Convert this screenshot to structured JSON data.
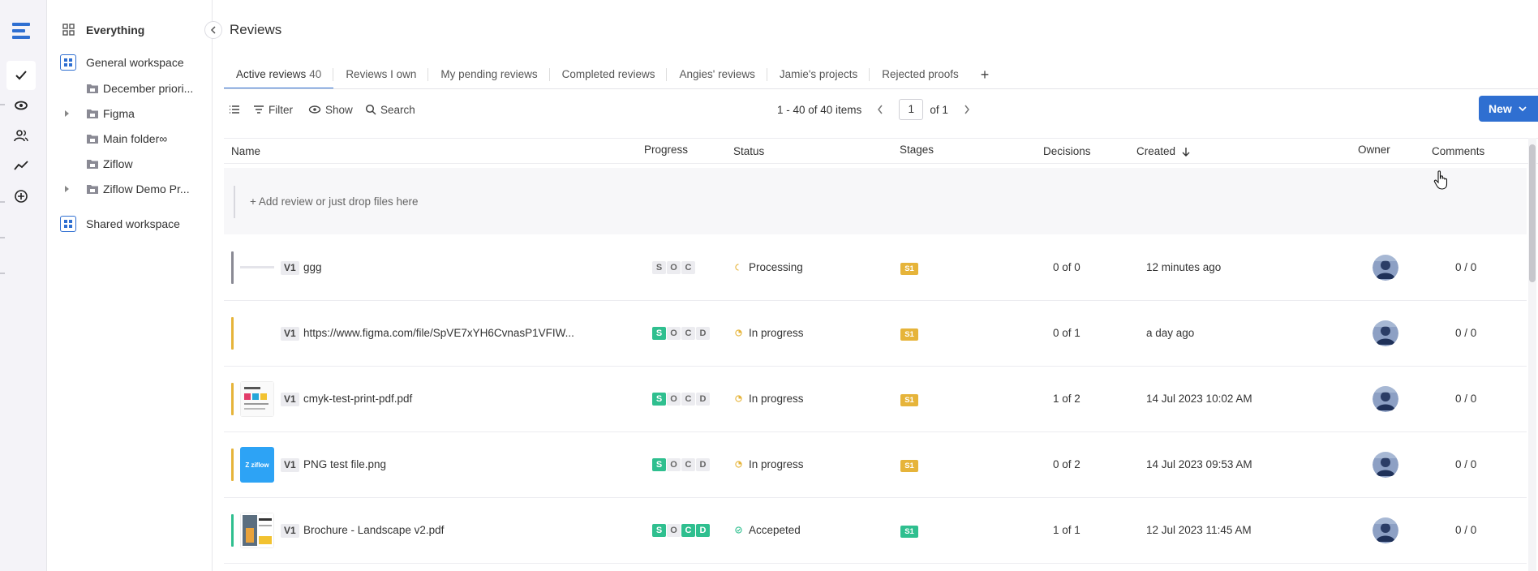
{
  "rail": {
    "icons": [
      "ziflow-logo-icon",
      "check-icon",
      "eye-icon",
      "users-icon",
      "chart-icon",
      "plus-circle-icon"
    ]
  },
  "sidebar": {
    "everything": "Everything",
    "general_workspace": "General workspace",
    "items": [
      {
        "label": "December priori...",
        "expandable": false
      },
      {
        "label": "Figma",
        "expandable": true
      },
      {
        "label": "Main folder∞",
        "expandable": false
      },
      {
        "label": "Ziflow",
        "expandable": false
      },
      {
        "label": "Ziflow Demo Pr...",
        "expandable": true
      }
    ],
    "shared_workspace": "Shared workspace"
  },
  "header": {
    "title": "Reviews"
  },
  "tabs": [
    {
      "label": "Active reviews",
      "count": "40",
      "active": true
    },
    {
      "label": "Reviews I own"
    },
    {
      "label": "My pending reviews"
    },
    {
      "label": "Completed reviews"
    },
    {
      "label": "Angies' reviews"
    },
    {
      "label": "Jamie's projects"
    },
    {
      "label": "Rejected proofs"
    }
  ],
  "toolbar": {
    "filter": "Filter",
    "show": "Show",
    "search": "Search",
    "new": "New"
  },
  "pager": {
    "range": "1 - 40 of 40 items",
    "page": "1",
    "of": "of 1"
  },
  "columns": {
    "name": "Name",
    "progress": "Progress",
    "status": "Status",
    "stages": "Stages",
    "decisions": "Decisions",
    "created": "Created",
    "owner": "Owner",
    "comments": "Comments"
  },
  "add_row": "+ Add review or just drop files here",
  "rows": [
    {
      "version": "V1",
      "name": "ggg",
      "progress": [
        "S",
        "O",
        "C"
      ],
      "progress_done": 0,
      "status": "Processing",
      "stage": "S1",
      "decisions": "0 of 0",
      "created": "12 minutes ago",
      "comments": "0 / 0",
      "accent": "#8a8a94"
    },
    {
      "version": "V1",
      "name": "https://www.figma.com/file/SpVE7xYH6CvnasP1VFIW...",
      "progress": [
        "S",
        "O",
        "C",
        "D"
      ],
      "progress_done": 1,
      "status": "In progress",
      "stage": "S1",
      "decisions": "0 of 1",
      "created": "a day ago",
      "comments": "0 / 0",
      "accent": "#e6b43a"
    },
    {
      "version": "V1",
      "name": "cmyk-test-print-pdf.pdf",
      "progress": [
        "S",
        "O",
        "C",
        "D"
      ],
      "progress_done": 1,
      "status": "In progress",
      "stage": "S1",
      "decisions": "1 of 2",
      "created": "14 Jul 2023 10:02 AM",
      "comments": "0 / 0",
      "accent": "#e6b43a"
    },
    {
      "version": "V1",
      "name": "PNG test file.png",
      "thumb_text": "Z ziflow",
      "progress": [
        "S",
        "O",
        "C",
        "D"
      ],
      "progress_done": 1,
      "status": "In progress",
      "stage": "S1",
      "decisions": "0 of 2",
      "created": "14 Jul 2023 09:53 AM",
      "comments": "0 / 0",
      "accent": "#e6b43a"
    },
    {
      "version": "V1",
      "name": "Brochure - Landscape v2.pdf",
      "progress": [
        "S",
        "O",
        "C",
        "D"
      ],
      "progress_done": 1,
      "progress_done_extra": [
        2,
        3
      ],
      "status": "Accepeted",
      "stage": "S1",
      "decisions": "1 of 1",
      "created": "12 Jul 2023 11:45 AM",
      "comments": "0 / 0",
      "accent": "#2fbf8f"
    }
  ],
  "colors": {
    "accent": "#2f6fd1",
    "green": "#2fbf8f",
    "yellow": "#e6b43a"
  }
}
